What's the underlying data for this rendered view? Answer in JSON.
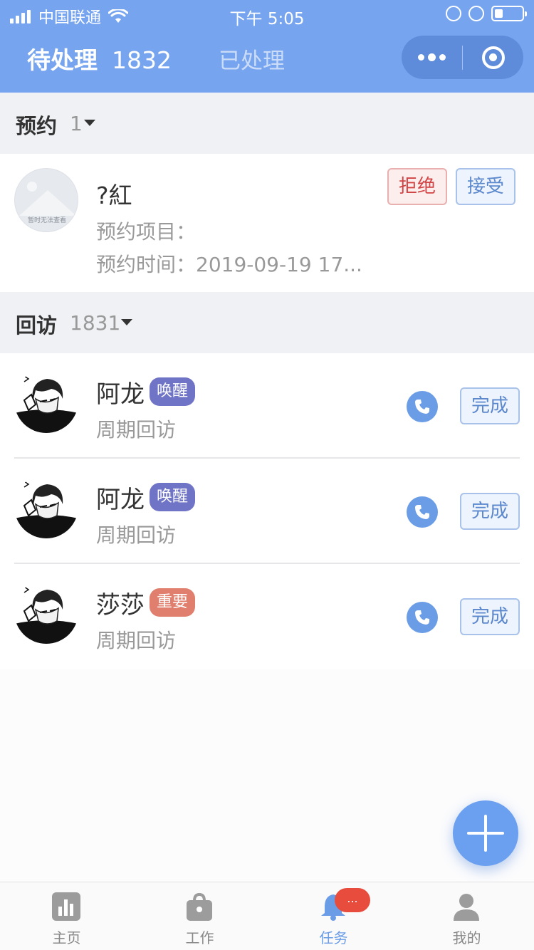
{
  "status_bar": {
    "carrier": "中国联通",
    "time": "下午 5:05",
    "battery_level": 0.3
  },
  "header": {
    "tab_pending_label": "待处理",
    "tab_pending_count": "1832",
    "tab_done_label": "已处理"
  },
  "appointments": {
    "title": "预约",
    "count": "1",
    "item": {
      "name": "?紅",
      "avatar_placeholder_text": "暂时无法查看",
      "project_line": "预约项目：",
      "time_line": "预约时间：2019-09-19 17...",
      "reject_label": "拒绝",
      "accept_label": "接受"
    }
  },
  "revisits": {
    "title": "回访",
    "count": "1831",
    "items": [
      {
        "name": "阿龙",
        "tag": "唤醒",
        "tag_color": "#6f74c6",
        "subtitle": "周期回访",
        "action_label": "完成"
      },
      {
        "name": "阿龙",
        "tag": "唤醒",
        "tag_color": "#6f74c6",
        "subtitle": "周期回访",
        "action_label": "完成"
      },
      {
        "name": "莎莎",
        "tag": "重要",
        "tag_color": "#e07f6e",
        "subtitle": "周期回访",
        "action_label": "完成"
      }
    ]
  },
  "bottom_nav": {
    "items": [
      {
        "label": "主页",
        "icon": "chart-icon"
      },
      {
        "label": "工作",
        "icon": "bag-icon"
      },
      {
        "label": "任务",
        "icon": "bell-icon",
        "badge": "..."
      },
      {
        "label": "我的",
        "icon": "user-icon"
      }
    ],
    "active_index": 2
  },
  "colors": {
    "header_bg": "#76a4ef",
    "accent": "#6b9de6",
    "reject": "#d24444",
    "badge": "#e74c3c"
  }
}
